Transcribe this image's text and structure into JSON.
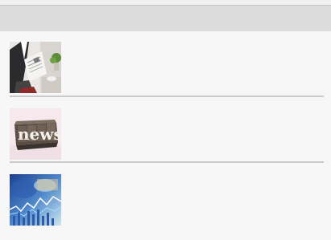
{
  "header": {
    "background": "#dcdcdc"
  },
  "list": {
    "items": [
      {
        "thumbnail_icon": "newspaper-reader-image"
      },
      {
        "thumbnail_icon": "news-type-image"
      },
      {
        "thumbnail_icon": "financial-chart-image"
      }
    ]
  }
}
